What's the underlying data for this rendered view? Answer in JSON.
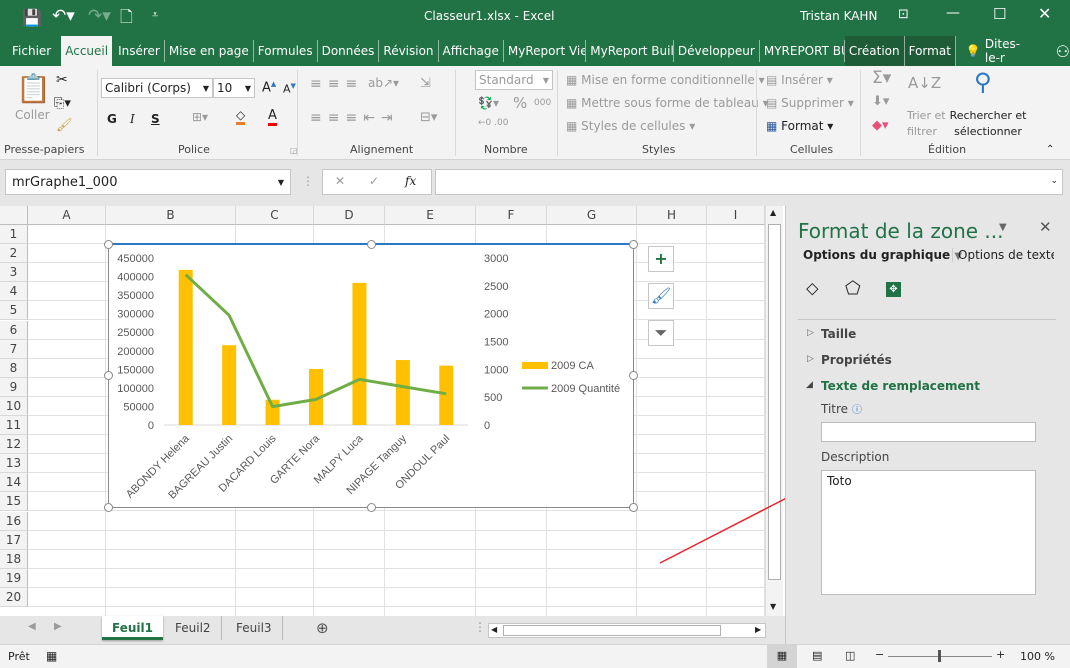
{
  "titlebar": {
    "title": "Classeur1.xlsx  -  Excel",
    "user": "Tristan KAHN"
  },
  "tabs": [
    "Fichier",
    "Accueil",
    "Insérer",
    "Mise en page",
    "Formules",
    "Données",
    "Révision",
    "Affichage",
    "MyReport Viewe",
    "MyReport Builde",
    "Développeur",
    "MYREPORT BUIL",
    "Création",
    "Format"
  ],
  "tell_me": "Dites-le-r",
  "ribbon": {
    "clipboard": {
      "paste": "Coller",
      "label": "Presse-papiers"
    },
    "font": {
      "name": "Calibri (Corps)",
      "size": "10",
      "bold": "G",
      "italic": "I",
      "underline": "S",
      "label": "Police"
    },
    "alignment": {
      "label": "Alignement"
    },
    "number": {
      "format": "Standard",
      "percent": "%",
      "label": "Nombre"
    },
    "styles": {
      "items": [
        "Mise en forme conditionnelle",
        "Mettre sous forme de tableau",
        "Styles de cellules"
      ],
      "label": "Styles"
    },
    "cells": {
      "items": [
        "Insérer",
        "Supprimer",
        "Format"
      ],
      "label": "Cellules"
    },
    "editing": {
      "sort": "Trier et filtrer",
      "find": "Rechercher et sélectionner",
      "label": "Édition"
    }
  },
  "formula_bar": {
    "name_box": "mrGraphe1_000",
    "fx": "fx",
    "value": ""
  },
  "grid": {
    "columns": [
      "A",
      "B",
      "C",
      "D",
      "E",
      "F",
      "G",
      "H",
      "I"
    ],
    "rows": [
      "1",
      "2",
      "3",
      "4",
      "5",
      "6",
      "7",
      "8",
      "9",
      "10",
      "11",
      "12",
      "13",
      "14",
      "15",
      "16",
      "17",
      "18",
      "19",
      "20"
    ]
  },
  "chart_data": {
    "type": "bar+line",
    "categories": [
      "ABONDY Helena",
      "BAGREAU Justin",
      "DACARD Louis",
      "GARTE Nora",
      "MALPY Luca",
      "NIPAGE Tanguy",
      "ONDOUL Paul"
    ],
    "series": [
      {
        "name": "2009 CA",
        "type": "bar",
        "axis": "left",
        "color": "#ffc000",
        "values": [
          418000,
          215000,
          68000,
          151000,
          383000,
          175000,
          160000
        ]
      },
      {
        "name": "2009 Quantité",
        "type": "line",
        "axis": "right",
        "color": "#70ad47",
        "values": [
          2700,
          1970,
          330,
          460,
          820,
          690,
          560
        ]
      }
    ],
    "y_left": {
      "range": [
        0,
        450000
      ],
      "ticks": [
        "0",
        "50000",
        "100000",
        "150000",
        "200000",
        "250000",
        "300000",
        "350000",
        "400000",
        "450000"
      ]
    },
    "y_right": {
      "range": [
        0,
        3000
      ],
      "ticks": [
        "0",
        "500",
        "1000",
        "1500",
        "2000",
        "2500",
        "3000"
      ]
    },
    "legend": "right",
    "grid": false
  },
  "panel": {
    "title": "Format de la zone ...",
    "tab_chart": "Options du graphique",
    "tab_text": "Options de texte",
    "sections": [
      "Taille",
      "Propriétés",
      "Texte de remplacement"
    ],
    "title_label": "Titre",
    "title_value": "",
    "description_label": "Description",
    "description_value": "Toto"
  },
  "sheets": {
    "tabs": [
      "Feuil1",
      "Feuil2",
      "Feuil3"
    ],
    "active": "Feuil1"
  },
  "status": {
    "ready": "Prêt",
    "zoom": "100 %"
  }
}
